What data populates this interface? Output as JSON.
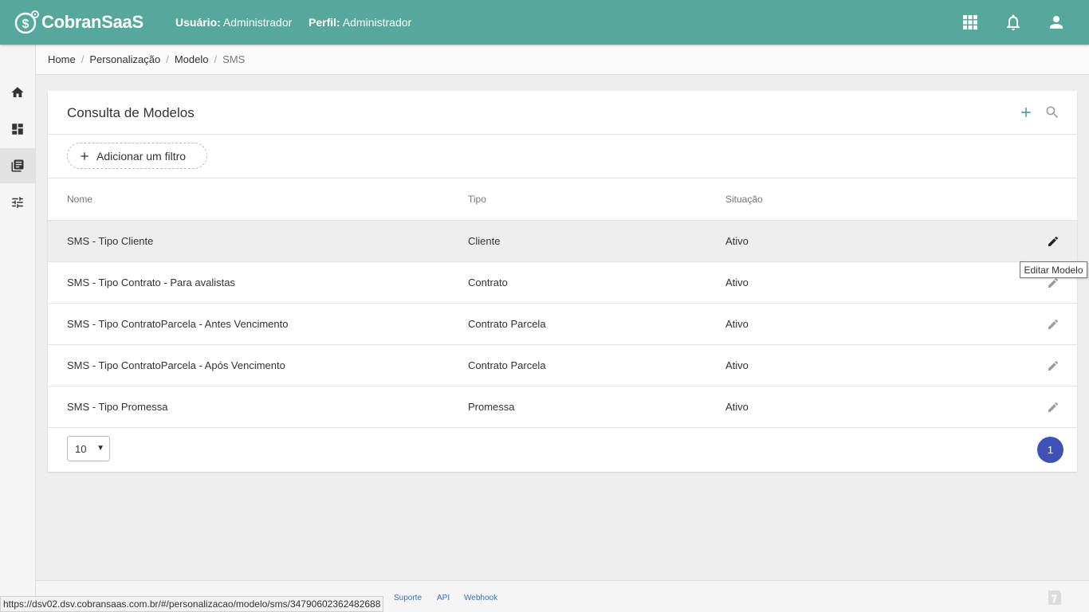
{
  "header": {
    "brand": "CobranSaaS",
    "user_label": "Usuário:",
    "user_value": "Administrador",
    "profile_label": "Perfil:",
    "profile_value": "Administrador",
    "icons": [
      "apps-grid-icon",
      "bell-icon",
      "user-icon"
    ]
  },
  "sidebar": {
    "items": [
      {
        "icon": "home-icon",
        "active": false
      },
      {
        "icon": "dashboard-icon",
        "active": false
      },
      {
        "icon": "library-icon",
        "active": true
      },
      {
        "icon": "tune-icon",
        "active": false
      }
    ]
  },
  "breadcrumb": {
    "items": [
      "Home",
      "Personalização",
      "Modelo",
      "SMS"
    ]
  },
  "card": {
    "title": "Consulta de Modelos",
    "add_filter_label": "Adicionar um filtro",
    "columns": [
      "Nome",
      "Tipo",
      "Situação"
    ],
    "rows": [
      {
        "nome": "SMS - Tipo Cliente",
        "tipo": "Cliente",
        "situacao": "Ativo"
      },
      {
        "nome": "SMS - Tipo Contrato - Para avalistas",
        "tipo": "Contrato",
        "situacao": "Ativo"
      },
      {
        "nome": "SMS - Tipo ContratoParcela - Antes Vencimento",
        "tipo": "Contrato Parcela",
        "situacao": "Ativo"
      },
      {
        "nome": "SMS - Tipo ContratoParcela - Após Vencimento",
        "tipo": "Contrato Parcela",
        "situacao": "Ativo"
      },
      {
        "nome": "SMS - Tipo Promessa",
        "tipo": "Promessa",
        "situacao": "Ativo"
      }
    ],
    "page_size": "10",
    "current_page": "1"
  },
  "tooltip": "Editar Modelo",
  "footer": {
    "links": [
      "Suporte",
      "API",
      "Webhook"
    ]
  },
  "status_url": "https://dsv02.dsv.cobransaas.com.br/#/personalizacao/modelo/sms/34790602362482688",
  "colors": {
    "header": "#55a89b",
    "accent": "#3f51b5",
    "add_icon": "#55a89b"
  }
}
